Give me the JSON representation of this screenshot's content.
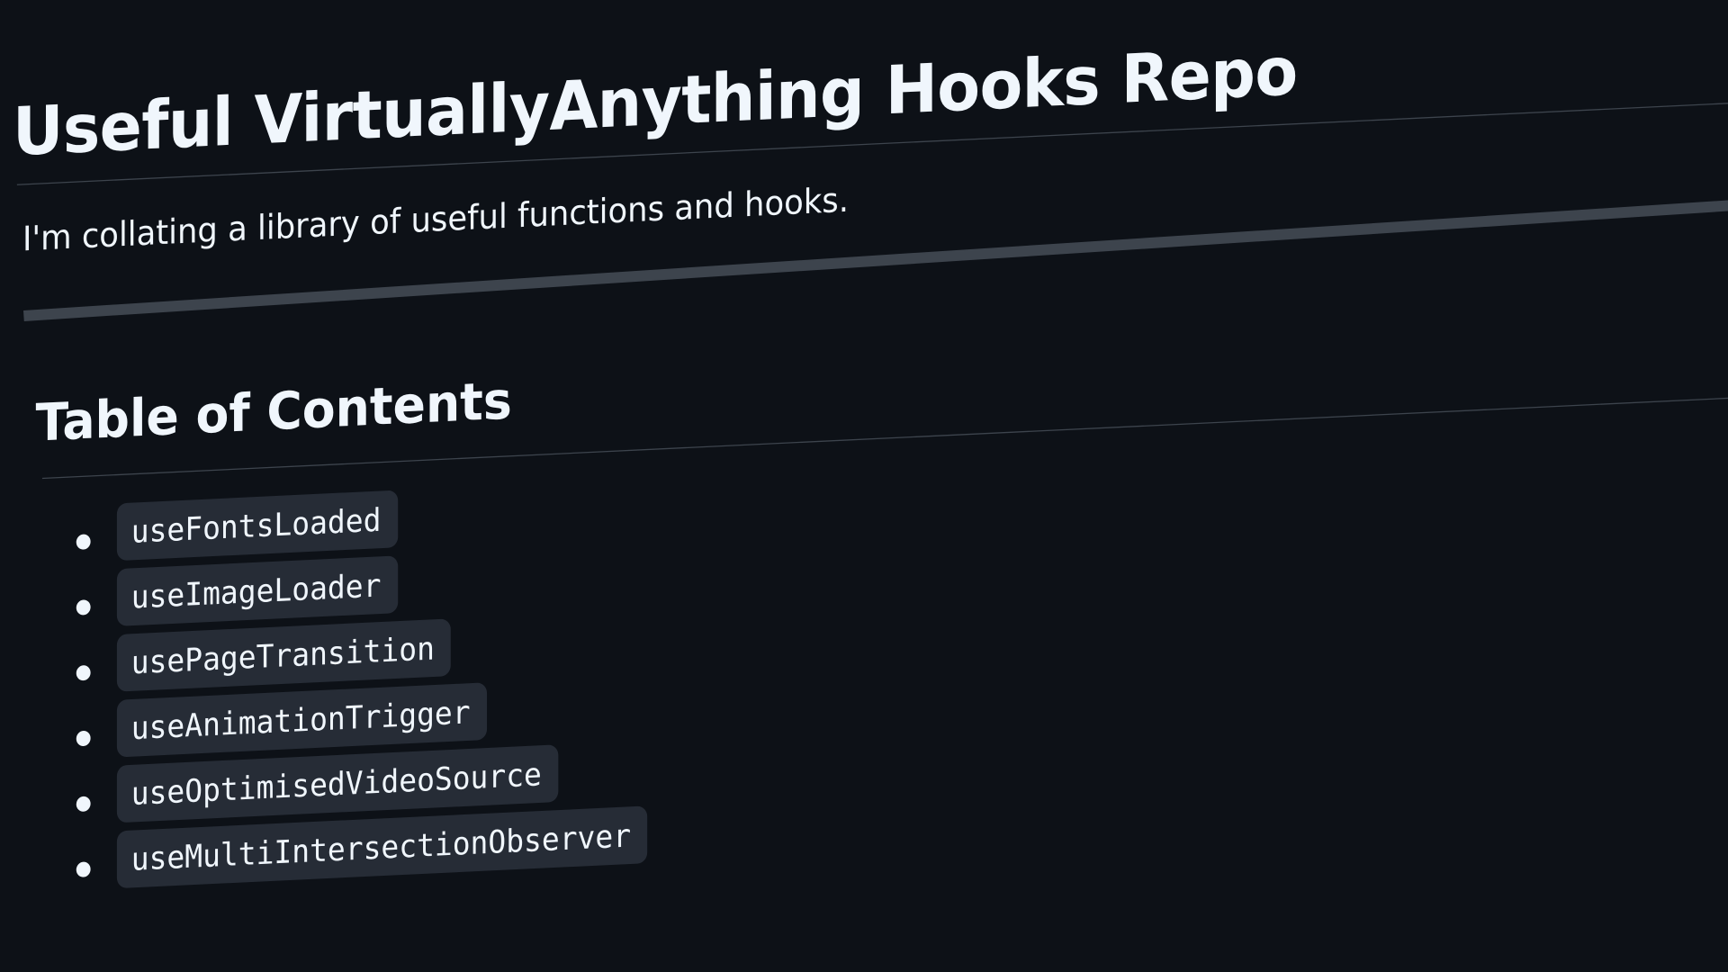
{
  "readme": {
    "title": "Useful VirtuallyAnything Hooks Repo",
    "intro": "I'm collating a library of useful functions and hooks.",
    "toc": {
      "heading": "Table of Contents",
      "items": [
        {
          "label": "useFontsLoaded"
        },
        {
          "label": "useImageLoader"
        },
        {
          "label": "usePageTransition"
        },
        {
          "label": "useAnimationTrigger"
        },
        {
          "label": "useOptimisedVideoSource"
        },
        {
          "label": "useMultiIntersectionObserver"
        }
      ]
    }
  },
  "colors": {
    "background": "#0d1117",
    "text": "#f0f6fc",
    "code_background": "#262c36",
    "rule": "#3d444d"
  }
}
